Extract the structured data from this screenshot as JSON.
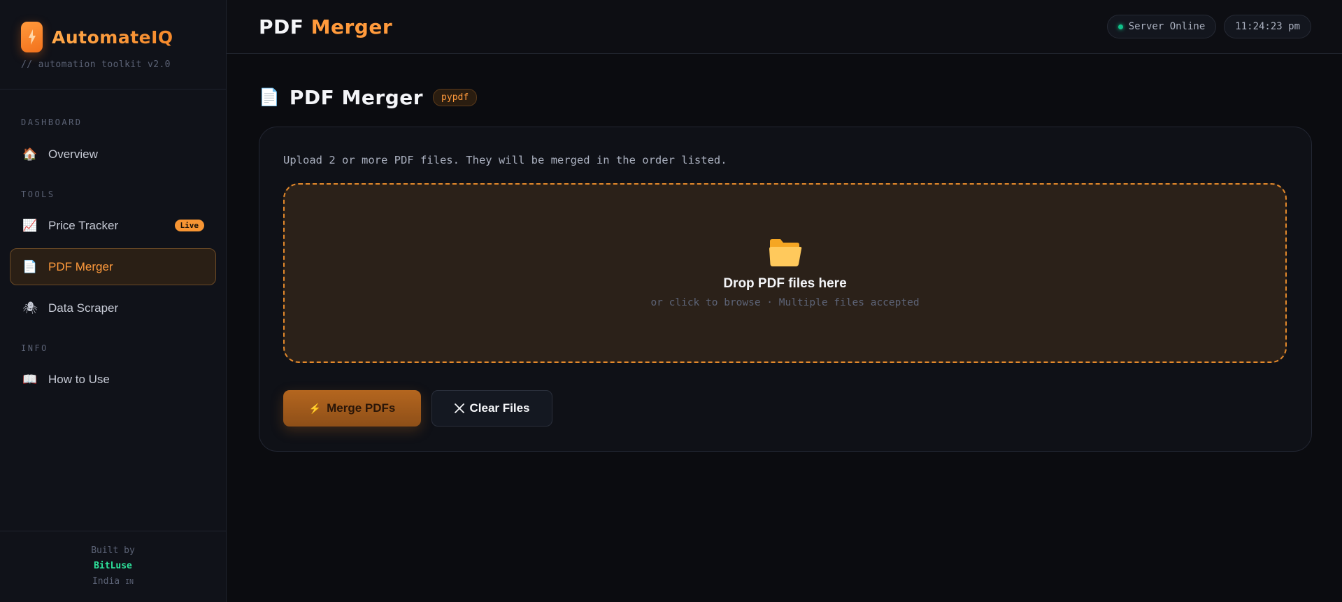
{
  "brand": {
    "name": "AutomateIQ",
    "subtitle": "// automation toolkit v2.0"
  },
  "sidebar": {
    "sections": [
      {
        "label": "DASHBOARD"
      },
      {
        "label": "TOOLS"
      },
      {
        "label": "INFO"
      }
    ],
    "items": [
      {
        "label": "Overview",
        "icon": "🏠",
        "icon_name": "house-icon"
      },
      {
        "label": "Price Tracker",
        "icon": "📈",
        "icon_name": "chart-increasing-icon",
        "badge": "Live"
      },
      {
        "label": "PDF Merger",
        "icon": "📄",
        "icon_name": "document-icon",
        "active": true
      },
      {
        "label": "Data Scraper",
        "icon": "🕷",
        "icon_name": "spider-icon"
      },
      {
        "label": "How to Use",
        "icon": "📖",
        "icon_name": "open-book-icon"
      }
    ],
    "footer": {
      "built_by": "Built by",
      "credit": "BitLuse",
      "location": "India",
      "flag": "IN"
    }
  },
  "topbar": {
    "title_part1": "PDF",
    "title_part2": "Merger",
    "status": "Server Online",
    "time": "11:24:23 pm"
  },
  "page": {
    "icon": "📄",
    "title": "PDF Merger",
    "tag": "pypdf",
    "description": "Upload 2 or more PDF files. They will be merged in the order listed.",
    "dropzone": {
      "title": "Drop PDF files here",
      "hint": "or click to browse · Multiple files accepted"
    },
    "buttons": {
      "merge_icon": "⚡",
      "merge_label": "Merge PDFs",
      "clear_label": "Clear Files"
    }
  },
  "colors": {
    "accent": "#ff9a3c",
    "background": "#0b0c10",
    "status_online": "#10c28a",
    "credit": "#2ee59d"
  }
}
